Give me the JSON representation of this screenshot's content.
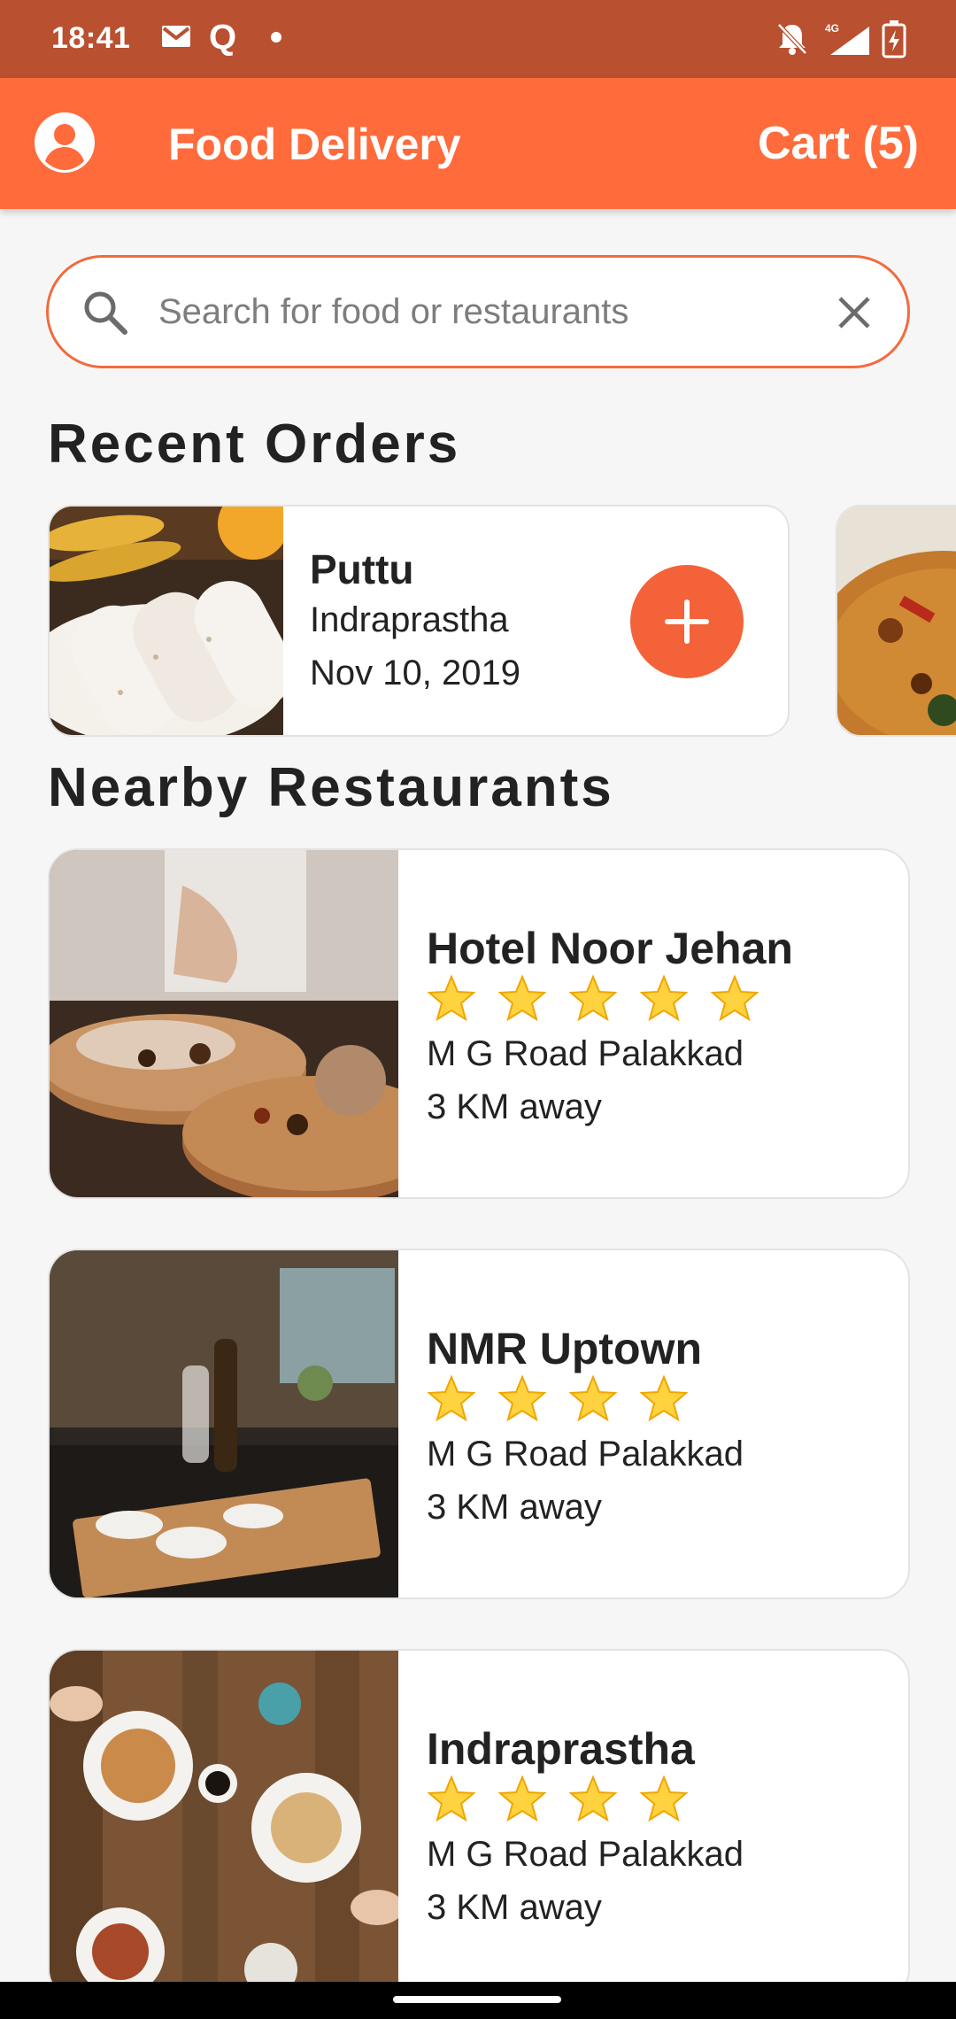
{
  "status_bar": {
    "time": "18:41",
    "q_glyph": "Q",
    "network_label": "4G"
  },
  "app_bar": {
    "title": "Food Delivery",
    "cart_label": "Cart (5)"
  },
  "search": {
    "placeholder": "Search for food or restaurants",
    "value": ""
  },
  "recent_orders": {
    "title": "Recent Orders",
    "items": [
      {
        "name": "Puttu",
        "restaurant": "Indraprastha",
        "date": "Nov 10, 2019"
      }
    ]
  },
  "nearby": {
    "title": "Nearby Restaurants",
    "items": [
      {
        "name": "Hotel Noor Jehan",
        "rating": 5,
        "address": "M G Road Palakkad",
        "distance": "3 KM away"
      },
      {
        "name": "NMR Uptown",
        "rating": 4,
        "address": "M G Road Palakkad",
        "distance": "3 KM away"
      },
      {
        "name": "Indraprastha",
        "rating": 4,
        "address": "M G Road Palakkad",
        "distance": "3 KM away"
      }
    ]
  },
  "colors": {
    "status_bar": "#b9502f",
    "app_bar": "#ff6b3b",
    "accent": "#f4623a",
    "star": "#ffd23f"
  },
  "icons": {
    "account": "account-circle-icon",
    "search": "search-icon",
    "clear": "close-icon",
    "add": "plus-icon",
    "star": "star-icon"
  }
}
